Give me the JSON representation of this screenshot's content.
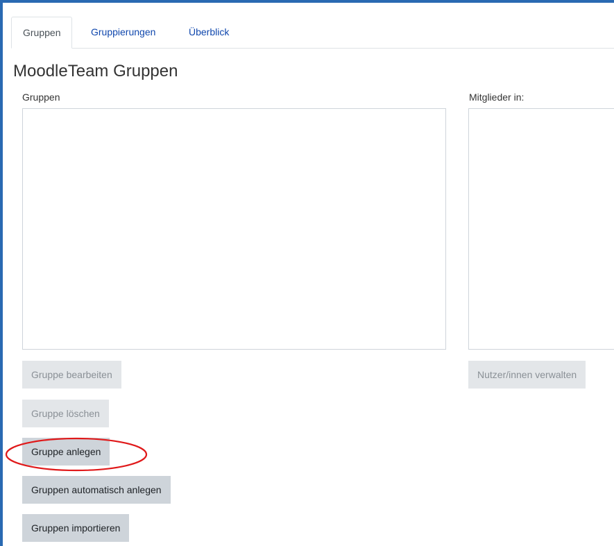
{
  "tabs": [
    {
      "label": "Gruppen",
      "active": true
    },
    {
      "label": "Gruppierungen",
      "active": false
    },
    {
      "label": "Überblick",
      "active": false
    }
  ],
  "page_title": "MoodleTeam Gruppen",
  "groups_column": {
    "label": "Gruppen"
  },
  "members_column": {
    "label": "Mitglieder in:"
  },
  "buttons": {
    "edit_group": "Gruppe bearbeiten",
    "delete_group": "Gruppe löschen",
    "create_group": "Gruppe anlegen",
    "auto_create_groups": "Gruppen automatisch anlegen",
    "import_groups": "Gruppen importieren",
    "manage_users": "Nutzer/innen verwalten"
  },
  "colors": {
    "accent_frame": "#2a6ab2",
    "link": "#0f47ad",
    "highlight_ring": "#e0191a"
  }
}
